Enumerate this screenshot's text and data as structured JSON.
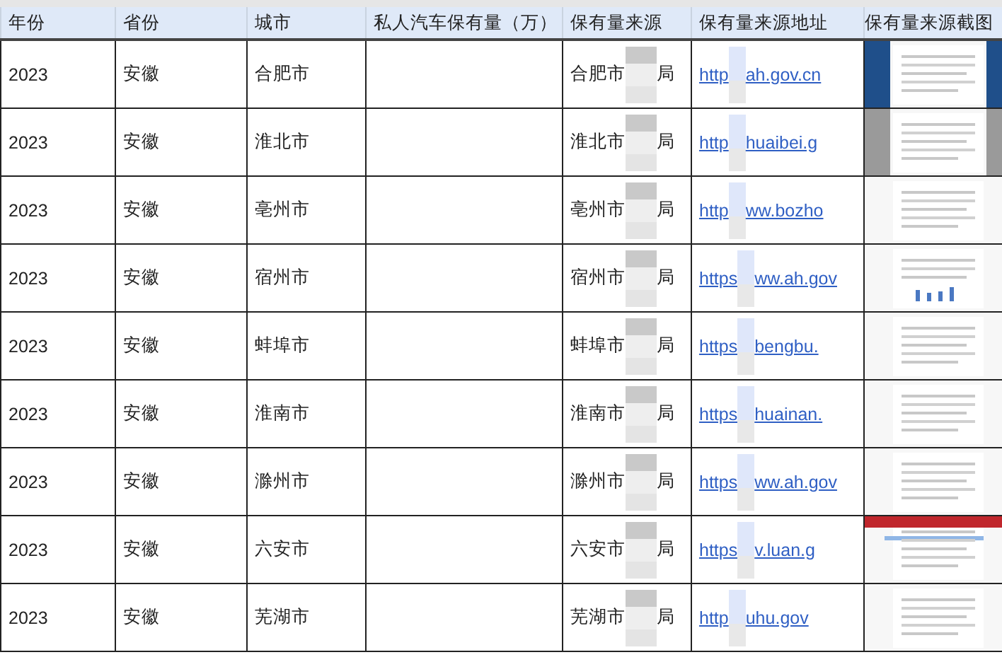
{
  "table": {
    "columns": [
      "年份",
      "省份",
      "城市",
      "私人汽车保有量（万）",
      "保有量来源",
      "保有量来源地址",
      "保有量来源截图"
    ],
    "rows": [
      {
        "year": "2023",
        "province": "安徽",
        "city": "合肥市",
        "source_start": "合肥市",
        "source_end": "局",
        "url_start": "http",
        "url_end": "ah.gov.cn"
      },
      {
        "year": "2023",
        "province": "安徽",
        "city": "淮北市",
        "source_start": "淮北市",
        "source_end": "局",
        "url_start": "http",
        "url_end": "huaibei.g"
      },
      {
        "year": "2023",
        "province": "安徽",
        "city": "亳州市",
        "source_start": "亳州市",
        "source_end": "局",
        "url_start": "http",
        "url_end": "ww.bozho"
      },
      {
        "year": "2023",
        "province": "安徽",
        "city": "宿州市",
        "source_start": "宿州市",
        "source_end": "局",
        "url_start": "https",
        "url_end": "ww.ah.gov"
      },
      {
        "year": "2023",
        "province": "安徽",
        "city": "蚌埠市",
        "source_start": "蚌埠市",
        "source_end": "局",
        "url_start": "https",
        "url_end": "bengbu."
      },
      {
        "year": "2023",
        "province": "安徽",
        "city": "淮南市",
        "source_start": "淮南市",
        "source_end": "局",
        "url_start": "https",
        "url_end": "huainan."
      },
      {
        "year": "2023",
        "province": "安徽",
        "city": "滁州市",
        "source_start": "滁州市",
        "source_end": "局",
        "url_start": "https",
        "url_end": "ww.ah.gov"
      },
      {
        "year": "2023",
        "province": "安徽",
        "city": "六安市",
        "source_start": "六安市",
        "source_end": "局",
        "url_start": "https",
        "url_end": "v.luan.g"
      },
      {
        "year": "2023",
        "province": "安徽",
        "city": "芜湖市",
        "source_start": "芜湖市",
        "source_end": "局",
        "url_start": "http",
        "url_end": "uhu.gov"
      }
    ]
  }
}
